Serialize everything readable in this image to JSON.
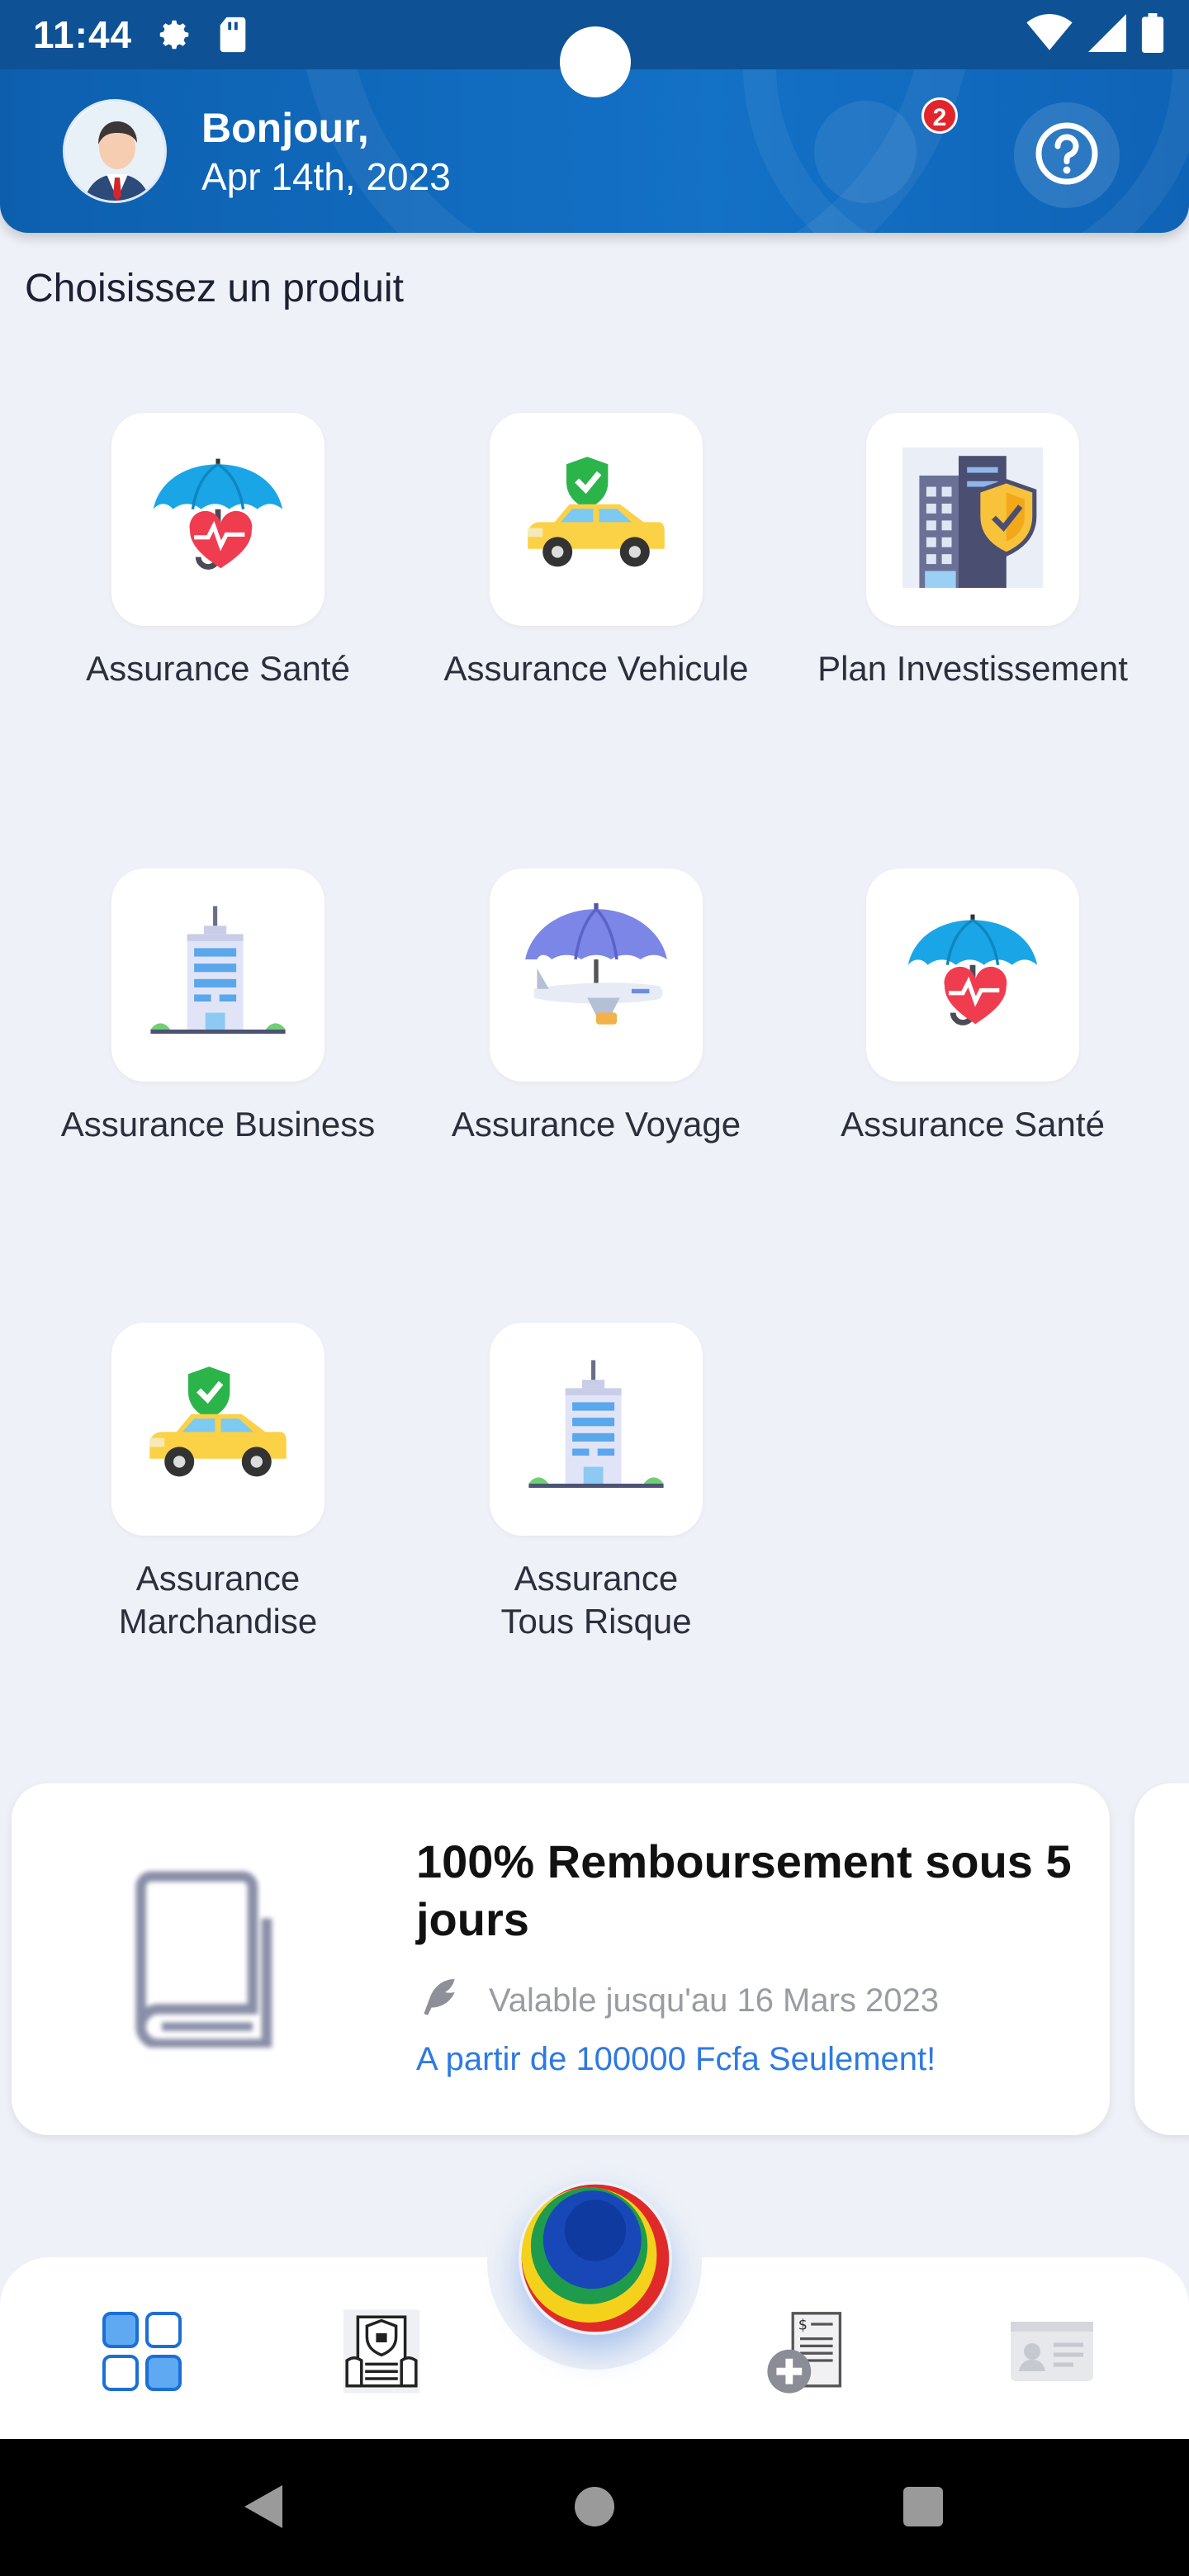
{
  "status_bar": {
    "time": "11:44",
    "icons": [
      "gear-icon",
      "sd-card-icon",
      "wifi-icon",
      "signal-icon",
      "battery-icon"
    ]
  },
  "header": {
    "greeting": "Bonjour,",
    "date": "Apr 14th, 2023",
    "notification_count": "2",
    "help_icon": "help-circle-icon"
  },
  "section_title": "Choisissez un produit",
  "products": [
    {
      "label": "Assurance Santé",
      "icon": "umbrella-heart-icon"
    },
    {
      "label": "Assurance Vehicule",
      "icon": "car-shield-icon"
    },
    {
      "label": "Plan Investissement",
      "icon": "building-shield-icon"
    },
    {
      "label": "Assurance Business",
      "icon": "office-building-icon"
    },
    {
      "label": "Assurance Voyage",
      "icon": "plane-umbrella-icon"
    },
    {
      "label": "Assurance Santé",
      "icon": "umbrella-heart-icon"
    },
    {
      "label": "Assurance Marchandise",
      "icon": "car-shield-icon"
    },
    {
      "label": "Assurance Tous Risque",
      "icon": "office-building-icon"
    }
  ],
  "promo": {
    "title": "100% Remboursement sous 5 jours",
    "validity": "Valable jusqu'au 16 Mars 2023",
    "offer": "A partir de 100000 Fcfa Seulement!"
  },
  "bottom_nav": {
    "items": [
      "dashboard-grid-icon",
      "secure-document-icon",
      "center-logo-icon",
      "medical-invoice-icon",
      "id-card-icon"
    ],
    "active": "dashboard-grid-icon"
  },
  "colors": {
    "header": "#0e5fae",
    "accent_blue": "#2d7ae0",
    "badge_red": "#e2252b",
    "background": "#eef1f7"
  }
}
